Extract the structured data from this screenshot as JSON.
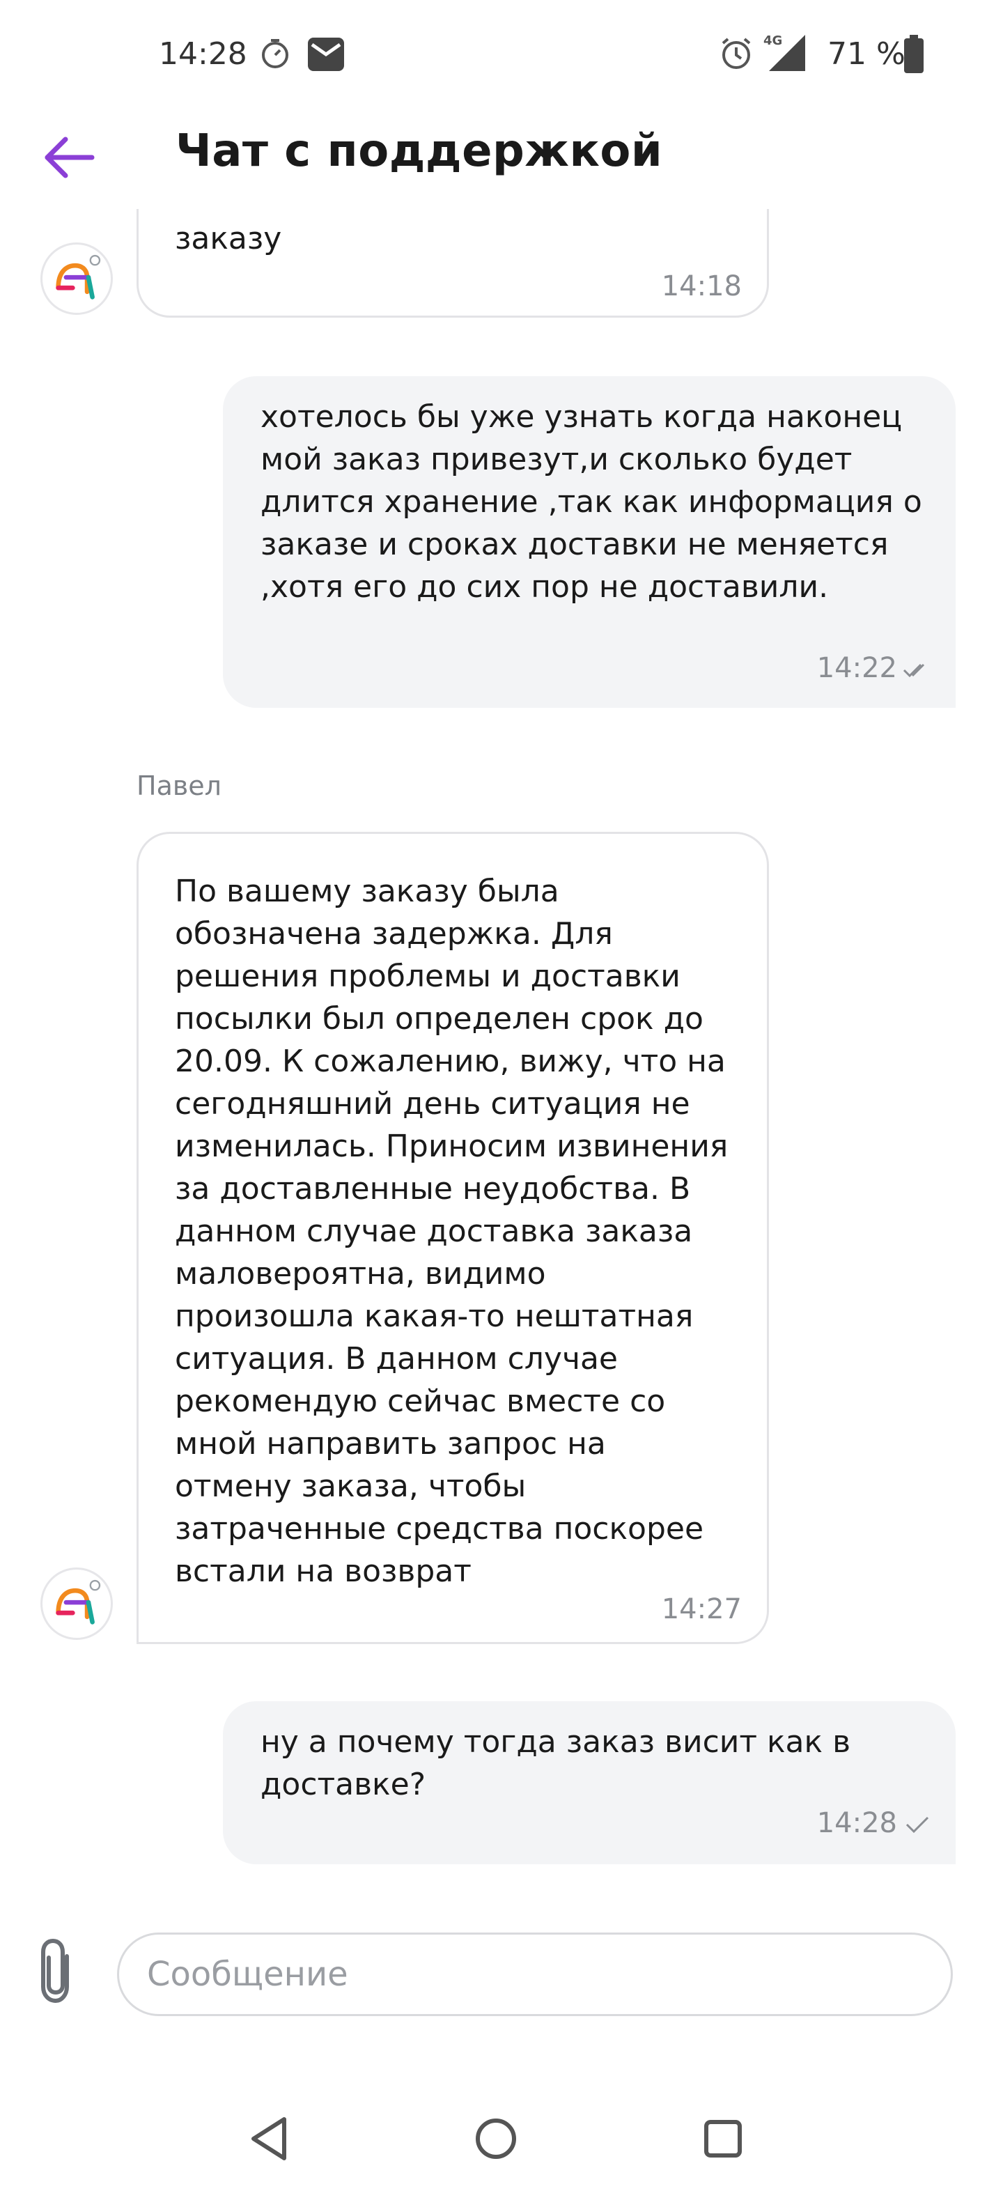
{
  "status_bar": {
    "time": "14:28",
    "battery": "71 %",
    "icons": [
      "stopwatch-icon",
      "mail-icon",
      "alarm-icon",
      "signal-4g-icon",
      "battery-icon"
    ]
  },
  "header": {
    "title": "Чат с поддержкой",
    "back_icon": "arrow-left-icon",
    "accent_color": "#8b3fd6"
  },
  "messages": [
    {
      "direction": "incoming",
      "text": "заказу",
      "time": "14:18"
    },
    {
      "direction": "outgoing",
      "text": "хотелось бы уже узнать когда наконец мой заказ привезут,и сколько будет длится хранение ,так как информация о заказе и сроках доставки не меняется ,хотя его до сих пор не доставили.",
      "time": "14:22",
      "status_icon": "double-check-icon"
    },
    {
      "direction": "incoming",
      "sender": "Павел",
      "text": "По вашему заказу была обозначена задержка. Для решения проблемы и доставки посылки был определен срок до 20.09. К сожалению, вижу, что на сегодняшний день ситуация не изменилась. Приносим извинения за доставленные неудобства. В данном случае доставка заказа маловероятна, видимо произошла какая-то нештатная ситуация. В данном случае рекомендую сейчас вместе со мной направить запрос на отмену заказа, чтобы затраченные средства поскорее встали на возврат",
      "time": "14:27"
    },
    {
      "direction": "outgoing",
      "text": "ну а почему тогда заказ висит как в доставке?",
      "time": "14:28",
      "status_icon": "check-icon"
    }
  ],
  "composer": {
    "placeholder": "Сообщение",
    "attach_icon": "paperclip-icon"
  },
  "nav_bar": {
    "icons": [
      "back-triangle-icon",
      "home-circle-icon",
      "recents-square-icon"
    ]
  }
}
